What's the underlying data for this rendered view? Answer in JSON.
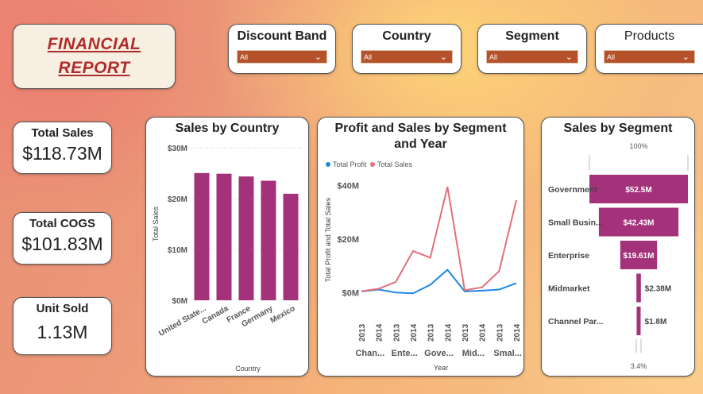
{
  "report_title": {
    "line1": "FINANCIAL",
    "line2": "REPORT"
  },
  "slicers": [
    {
      "label": "Discount Band",
      "value": "All"
    },
    {
      "label": "Country",
      "value": "All"
    },
    {
      "label": "Segment",
      "value": "All"
    },
    {
      "label": "Products",
      "value": "All"
    }
  ],
  "kpis": [
    {
      "label": "Total Sales",
      "value": "$118.73M"
    },
    {
      "label": "Total COGS",
      "value": "$101.83M"
    },
    {
      "label": "Unit Sold",
      "value": "1.13M"
    }
  ],
  "colors": {
    "bar": "#a3327a",
    "profit": "#1e88e5",
    "sales": "#e0707a"
  },
  "chart_data": [
    {
      "type": "bar",
      "title": "Sales by Country",
      "xlabel": "Country",
      "ylabel": "Total Sales",
      "categories": [
        "United State...",
        "Canada",
        "France",
        "Germany",
        "Mexico"
      ],
      "values": [
        25.03,
        24.89,
        24.35,
        23.51,
        20.95
      ],
      "ylim": [
        0,
        30
      ],
      "yticks": [
        "$0M",
        "$10M",
        "$20M",
        "$30M"
      ],
      "grid": true
    },
    {
      "type": "line",
      "title": "Profit and Sales by Segment and Year",
      "xlabel": "Year",
      "ylabel": "Total Profit and Total Sales",
      "years": [
        "2013",
        "2014",
        "2013",
        "2014",
        "2013",
        "2014",
        "2013",
        "2014",
        "2013",
        "2014"
      ],
      "groups": [
        "Chan...",
        "Ente...",
        "Gove...",
        "Mid...",
        "Smal..."
      ],
      "series": [
        {
          "name": "Total Profit",
          "values": [
            0.4,
            1.1,
            0.0,
            -0.3,
            2.9,
            8.5,
            0.4,
            0.7,
            1.1,
            3.5
          ]
        },
        {
          "name": "Total Sales",
          "values": [
            0.5,
            1.4,
            4.0,
            15.5,
            13.0,
            39.5,
            0.9,
            1.9,
            8.0,
            34.5
          ]
        }
      ],
      "ylim": [
        -2,
        44
      ],
      "yticks": [
        "$0M",
        "$20M",
        "$40M"
      ],
      "legend": "top-left"
    },
    {
      "type": "funnel",
      "title": "Sales by Segment",
      "top_label": "100%",
      "bottom_label": "3.4%",
      "categories": [
        "Government",
        "Small Busin...",
        "Enterprise",
        "Midmarket",
        "Channel Par..."
      ],
      "values": [
        52.5,
        42.43,
        19.61,
        2.38,
        1.8
      ],
      "labels": [
        "$52.5M",
        "$42.43M",
        "$19.61M",
        "$2.38M",
        "$1.8M"
      ]
    }
  ]
}
